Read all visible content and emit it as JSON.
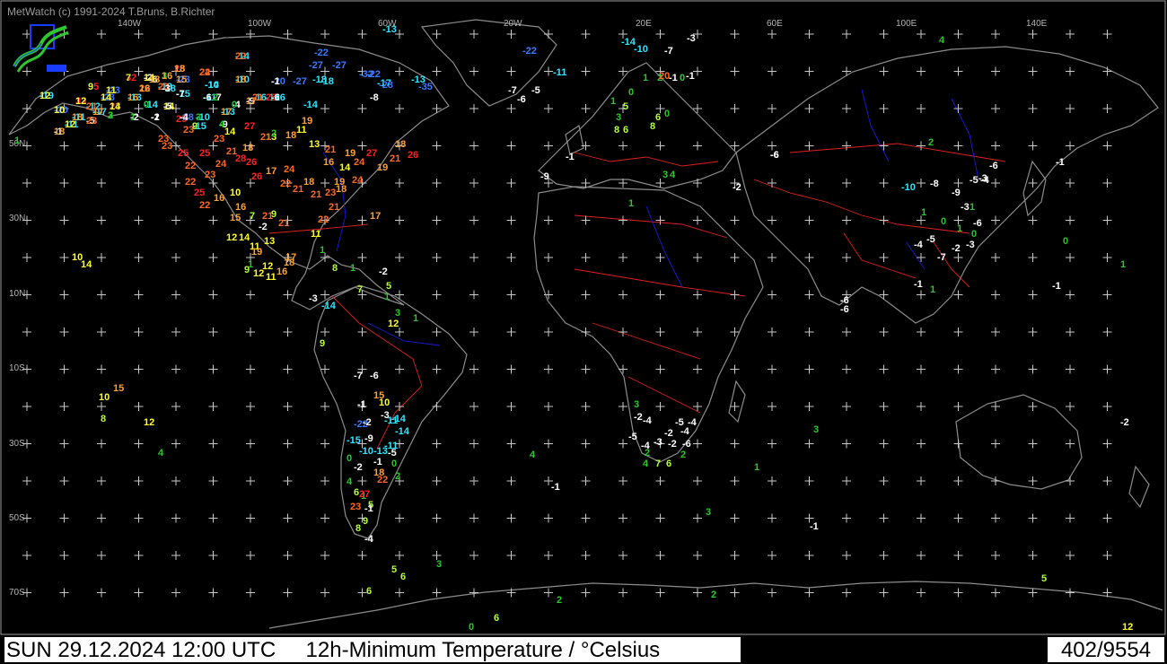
{
  "header": {
    "copyright": "MetWatch  (c) 1991-2024 T.Bruns, B.Richter"
  },
  "footer": {
    "date": "SUN 29.12.2024 12:00 UTC",
    "product": "12h-Minimum Temperature / °Celsius",
    "station_count": "402/9554"
  },
  "colors": {
    "background": "#000000",
    "coastline": "#8c8c8c",
    "borders": "#e02020",
    "rivers": "#1a1ae0",
    "grid_marker": "#c8c8c8",
    "temp_scale": {
      "le_-20": "#3a7aff",
      "-19_to_-10": "#2ee6ff",
      "-9_to_-1": "#ffffff",
      "0_to_4": "#28c828",
      "5_to_9": "#b4ff3c",
      "10_to_14": "#ffff2a",
      "15_to_19": "#ffa030",
      "20_to_24": "#ff6820",
      "ge_25": "#ff2020"
    }
  },
  "axes": {
    "longitudes": [
      "140W",
      "100W",
      "60W",
      "20W",
      "20E",
      "60E",
      "100E",
      "140E"
    ],
    "latitudes": [
      "50N",
      "30N",
      "10N",
      "10S",
      "30S",
      "50S",
      "70S"
    ]
  },
  "stations": [
    -19,
    -20,
    33,
    35,
    -23,
    32,
    -2,
    -6,
    3,
    25,
    -23,
    24,
    -18,
    22,
    -17,
    -11,
    -12,
    -1,
    -11,
    -5,
    -13,
    -23,
    23,
    3,
    1,
    -1,
    -14,
    14,
    -18,
    -15,
    -14,
    -11,
    -28,
    -10,
    -7,
    -15,
    -13,
    -9,
    -4,
    -9,
    -14,
    -10,
    -16,
    -12,
    -16,
    -20,
    -27,
    -18,
    -22,
    -27,
    -27,
    -14,
    -18,
    -22,
    -8,
    -17,
    -28,
    -32,
    -13,
    -35,
    -13,
    -22,
    -11,
    -14,
    -10,
    -7,
    -3,
    -7,
    -6,
    -5,
    4,
    1,
    2,
    -1,
    0,
    20,
    -1,
    0,
    1,
    5,
    3,
    6,
    8,
    6,
    0,
    8,
    4,
    3,
    -9,
    -6,
    -1,
    -2,
    1,
    -6,
    2,
    -6,
    -3,
    -1,
    -10,
    -8,
    -9,
    -5,
    -4,
    -3,
    1,
    1,
    0,
    1,
    0,
    -6,
    -4,
    -5,
    -7,
    -2,
    -3,
    0,
    1,
    -1,
    -6,
    -6,
    -1,
    1,
    3,
    -2,
    -4,
    -5,
    -4,
    -2,
    -4,
    -5,
    -4,
    -3,
    -2,
    -6,
    2,
    2,
    4,
    7,
    6,
    3,
    1,
    -2,
    4,
    -1,
    3,
    -1,
    5,
    6,
    3,
    6,
    2,
    2,
    5,
    12,
    6,
    0,
    1,
    10,
    14,
    4,
    10,
    15,
    8,
    12,
    17,
    13,
    16,
    18,
    21,
    22,
    11,
    17,
    1,
    8,
    1,
    -2,
    1,
    7,
    5,
    3,
    1,
    12,
    -3,
    -14,
    9,
    -7,
    -6,
    -1,
    15,
    10,
    -3,
    -11,
    -14,
    -22,
    -2,
    -14,
    -15,
    -9,
    -10,
    -13,
    -11,
    -5,
    0,
    -2,
    -1,
    0,
    2,
    4,
    6,
    1,
    5,
    9,
    8,
    -4,
    -1,
    23,
    27,
    22,
    18,
    25,
    25,
    22,
    23,
    24,
    21,
    18,
    21,
    2,
    18,
    11,
    19,
    13,
    21,
    14,
    19,
    24,
    27,
    19,
    18,
    26,
    21,
    23,
    25,
    23,
    23,
    23,
    14,
    27,
    28,
    26,
    26,
    17,
    24,
    22,
    21,
    18,
    21,
    23,
    19,
    24,
    22,
    25,
    22,
    16,
    10,
    15,
    16,
    7,
    21,
    9,
    -2,
    21,
    12,
    14,
    11,
    13,
    19,
    1,
    12,
    18,
    16,
    12,
    11,
    9,
    12,
    10,
    12,
    9,
    11,
    7,
    14,
    18,
    16,
    18,
    15,
    22,
    20,
    16,
    17,
    18,
    21,
    18,
    12,
    23,
    16,
    14,
    14,
    2,
    -2,
    -2,
    0,
    -5,
    -3,
    -7,
    -10,
    -6,
    -4,
    3,
    2,
    9,
    17,
    4,
    0,
    17,
    22,
    18,
    21,
    25,
    -6,
    -1
  ]
}
